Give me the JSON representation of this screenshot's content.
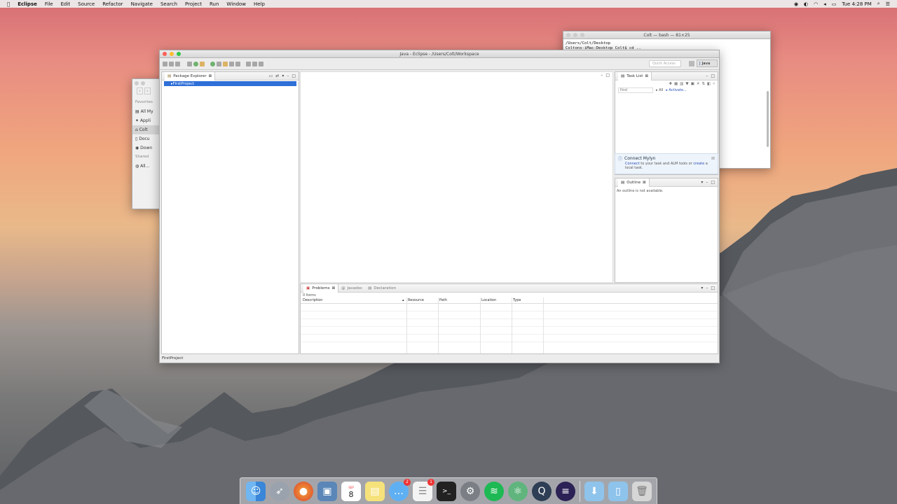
{
  "menubar": {
    "apple": "",
    "items": [
      "Eclipse",
      "File",
      "Edit",
      "Source",
      "Refactor",
      "Navigate",
      "Search",
      "Project",
      "Run",
      "Window",
      "Help"
    ],
    "clock": "Tue 4:28 PM"
  },
  "terminal": {
    "title": "Colt — bash — 81×25",
    "lines": [
      "/Users/Colt/Desktop",
      "Coltons-iMac:Desktop Colt$ cd .."
    ]
  },
  "finder": {
    "sections": [
      {
        "label": "Favorites",
        "items": [
          "All My",
          "Appli",
          "Colt",
          "Docu",
          "Down"
        ]
      },
      {
        "label": "Shared",
        "items": [
          "All..."
        ]
      }
    ]
  },
  "eclipse": {
    "title": "Java - Eclipse - /Users/Colt/Workspace",
    "quick_access": "Quick Access",
    "perspective": "Java",
    "package_explorer": {
      "tab": "Package Explorer",
      "project": "FirstProject"
    },
    "task_list": {
      "tab": "Task List",
      "find_placeholder": "Find",
      "all": "All",
      "activate": "Activate..."
    },
    "mylyn": {
      "title": "Connect Mylyn",
      "text_pre": "to your task and ALM tools or",
      "connect": "Connect",
      "create": "create",
      "text_post": "a local task."
    },
    "outline": {
      "tab": "Outline",
      "message": "An outline is not available."
    },
    "problems": {
      "tabs": [
        "Problems",
        "Javadoc",
        "Declaration"
      ],
      "count": "0 items",
      "columns": [
        "Description",
        "Resource",
        "Path",
        "Location",
        "Type"
      ]
    },
    "status": "FirstProject"
  },
  "dock": {
    "apps": [
      "finder",
      "launchpad",
      "firefox",
      "preview",
      "calendar",
      "notes",
      "messages",
      "reminders",
      "terminal",
      "system-preferences",
      "spotify",
      "atom",
      "quicktime",
      "eclipse",
      "downloads-folder",
      "documents-folder",
      "trash"
    ],
    "calendar_month": "SEP",
    "calendar_day": "8",
    "messages_badge": "2",
    "reminders_badge": "1"
  }
}
